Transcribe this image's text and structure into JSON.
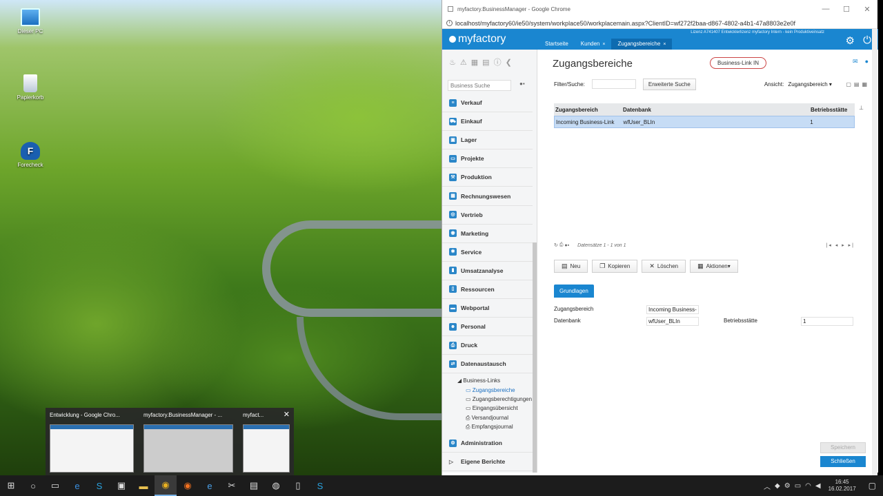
{
  "desktop": {
    "icons": [
      {
        "label": "Dieser PC",
        "icon": "computer-icon"
      },
      {
        "label": "Papierkorb",
        "icon": "recycle-bin-icon"
      },
      {
        "label": "Forecheck",
        "icon": "forecheck-icon"
      }
    ],
    "thumbnails": [
      {
        "title": "Entwicklung - Google Chro..."
      },
      {
        "title": "myfactory.BusinessManager - ..."
      },
      {
        "title": "myfact..."
      }
    ]
  },
  "browser": {
    "title": "myfactory.BusinessManager - Google Chrome",
    "url": "localhost/myfactory60/ie50/system/workplace50/workplacemain.aspx?ClientID=wf272f2baa-d867-4802-a4b1-47a8803e2e0f"
  },
  "app": {
    "logo": "myfactory",
    "license": "Lizenz A741407 Entwicklerlizenz myfactory Intern - kein Produktiveinsatz",
    "tabs": [
      {
        "label": "Startseite",
        "closable": false
      },
      {
        "label": "Kunden",
        "closable": true
      },
      {
        "label": "Zugangsbereiche",
        "closable": true
      }
    ],
    "close_symbol": "×"
  },
  "sidebar": {
    "search_placeholder": "Business Suche",
    "items": [
      {
        "label": "Verkauf",
        "icon": "sales-icon"
      },
      {
        "label": "Einkauf",
        "icon": "cart-icon"
      },
      {
        "label": "Lager",
        "icon": "warehouse-icon"
      },
      {
        "label": "Projekte",
        "icon": "projects-icon"
      },
      {
        "label": "Produktion",
        "icon": "production-icon"
      },
      {
        "label": "Rechnungswesen",
        "icon": "accounting-icon"
      },
      {
        "label": "Vertrieb",
        "icon": "distribution-icon"
      },
      {
        "label": "Marketing",
        "icon": "marketing-icon"
      },
      {
        "label": "Service",
        "icon": "service-icon"
      },
      {
        "label": "Umsatzanalyse",
        "icon": "analysis-icon"
      },
      {
        "label": "Ressourcen",
        "icon": "resources-icon"
      },
      {
        "label": "Webportal",
        "icon": "webportal-icon"
      },
      {
        "label": "Personal",
        "icon": "personnel-icon"
      },
      {
        "label": "Druck",
        "icon": "print-icon"
      },
      {
        "label": "Datenaustausch",
        "icon": "data-exchange-icon"
      }
    ],
    "sub": {
      "parent": "Business-Links",
      "children": [
        "Zugangsbereiche",
        "Zugangsberechtigungen",
        "Eingangsübersicht",
        "Versandjournal",
        "Empfangsjournal"
      ]
    },
    "footer_items": [
      {
        "label": "Administration",
        "icon": "admin-icon"
      },
      {
        "label": "Eigene Berichte",
        "icon": "reports-icon"
      }
    ]
  },
  "main": {
    "title": "Zugangsbereiche",
    "chip": "Business-Link IN",
    "filter_label": "Filter/Suche:",
    "extended_search": "Erweiterte Suche",
    "view_label": "Ansicht:",
    "view_value": "Zugangsbereich",
    "grid": {
      "headers": [
        "Zugangsbereich",
        "Datenbank",
        "Betriebsstätte"
      ],
      "rows": [
        [
          "Incoming Business-Link",
          "wfUser_BLIn",
          "1"
        ]
      ]
    },
    "pager_text": "Datensätze 1 - 1 von 1",
    "actions": {
      "new": "Neu",
      "copy": "Kopieren",
      "delete": "Löschen",
      "more": "Aktionen"
    },
    "tab": "Grundlagen",
    "form": {
      "zugangsbereich_label": "Zugangsbereich",
      "zugangsbereich_value": "Incoming Business-",
      "datenbank_label": "Datenbank",
      "datenbank_value": "wfUser_BLIn",
      "betriebsstaette_label": "Betriebsstätte",
      "betriebsstaette_value": "1"
    },
    "save": "Speichern",
    "close": "Schließen"
  },
  "taskbar": {
    "time": "16:45",
    "date": "16.02.2017"
  }
}
